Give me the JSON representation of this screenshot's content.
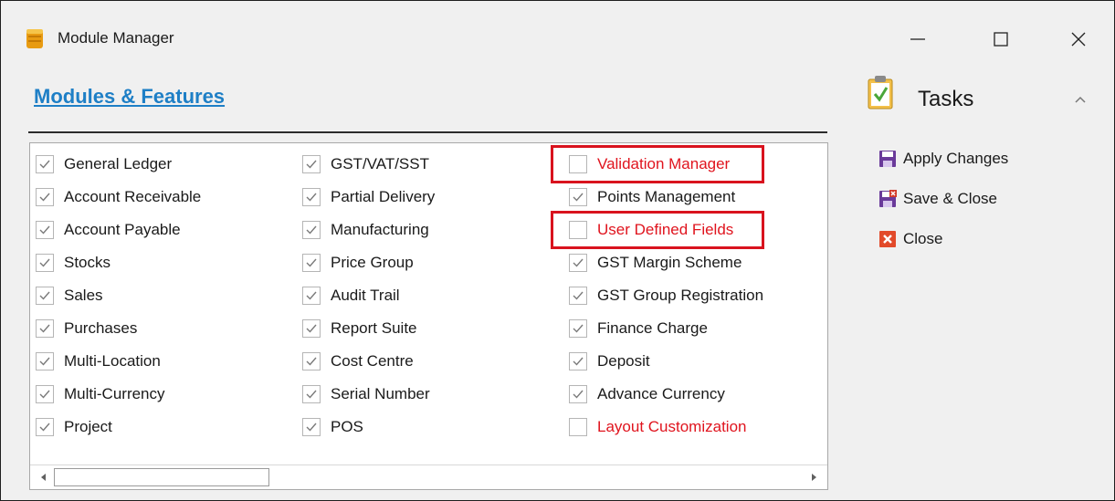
{
  "window": {
    "title": "Module Manager",
    "icon": "module-manager-icon",
    "controls": {
      "minimize_icon": "minimize-icon",
      "maximize_icon": "maximize-icon",
      "close_icon": "close-icon"
    }
  },
  "main": {
    "heading": "Modules & Features",
    "columns": [
      {
        "items": [
          {
            "label": "General Ledger",
            "checked": true
          },
          {
            "label": "Account Receivable",
            "checked": true
          },
          {
            "label": "Account Payable",
            "checked": true
          },
          {
            "label": "Stocks",
            "checked": true
          },
          {
            "label": "Sales",
            "checked": true
          },
          {
            "label": "Purchases",
            "checked": true
          },
          {
            "label": "Multi-Location",
            "checked": true
          },
          {
            "label": "Multi-Currency",
            "checked": true
          },
          {
            "label": "Project",
            "checked": true
          }
        ]
      },
      {
        "items": [
          {
            "label": "GST/VAT/SST",
            "checked": true
          },
          {
            "label": "Partial Delivery",
            "checked": true
          },
          {
            "label": "Manufacturing",
            "checked": true
          },
          {
            "label": "Price Group",
            "checked": true
          },
          {
            "label": "Audit Trail",
            "checked": true
          },
          {
            "label": "Report Suite",
            "checked": true
          },
          {
            "label": "Cost Centre",
            "checked": true
          },
          {
            "label": "Serial Number",
            "checked": true
          },
          {
            "label": "POS",
            "checked": true
          }
        ]
      },
      {
        "items": [
          {
            "label": "Validation Manager",
            "checked": false,
            "highlight": true,
            "boxed": true
          },
          {
            "label": "Points Management",
            "checked": true
          },
          {
            "label": "User Defined Fields",
            "checked": false,
            "highlight": true,
            "boxed": true
          },
          {
            "label": "GST Margin Scheme",
            "checked": true
          },
          {
            "label": "GST Group Registration",
            "checked": true
          },
          {
            "label": "Finance Charge",
            "checked": true
          },
          {
            "label": "Deposit",
            "checked": true
          },
          {
            "label": "Advance Currency",
            "checked": true
          },
          {
            "label": "Layout Customization",
            "checked": false,
            "highlight": true
          }
        ]
      }
    ]
  },
  "tasks": {
    "title": "Tasks",
    "icon": "clipboard-check-icon",
    "collapse_icon": "chevron-up-icon",
    "items": [
      {
        "label": "Apply Changes",
        "icon": "save-icon"
      },
      {
        "label": "Save & Close",
        "icon": "save-close-icon"
      },
      {
        "label": "Close",
        "icon": "close-red-icon"
      }
    ]
  },
  "colors": {
    "heading": "#1e7fc6",
    "highlight_text": "#e0141e",
    "highlight_box": "#d9131e"
  }
}
